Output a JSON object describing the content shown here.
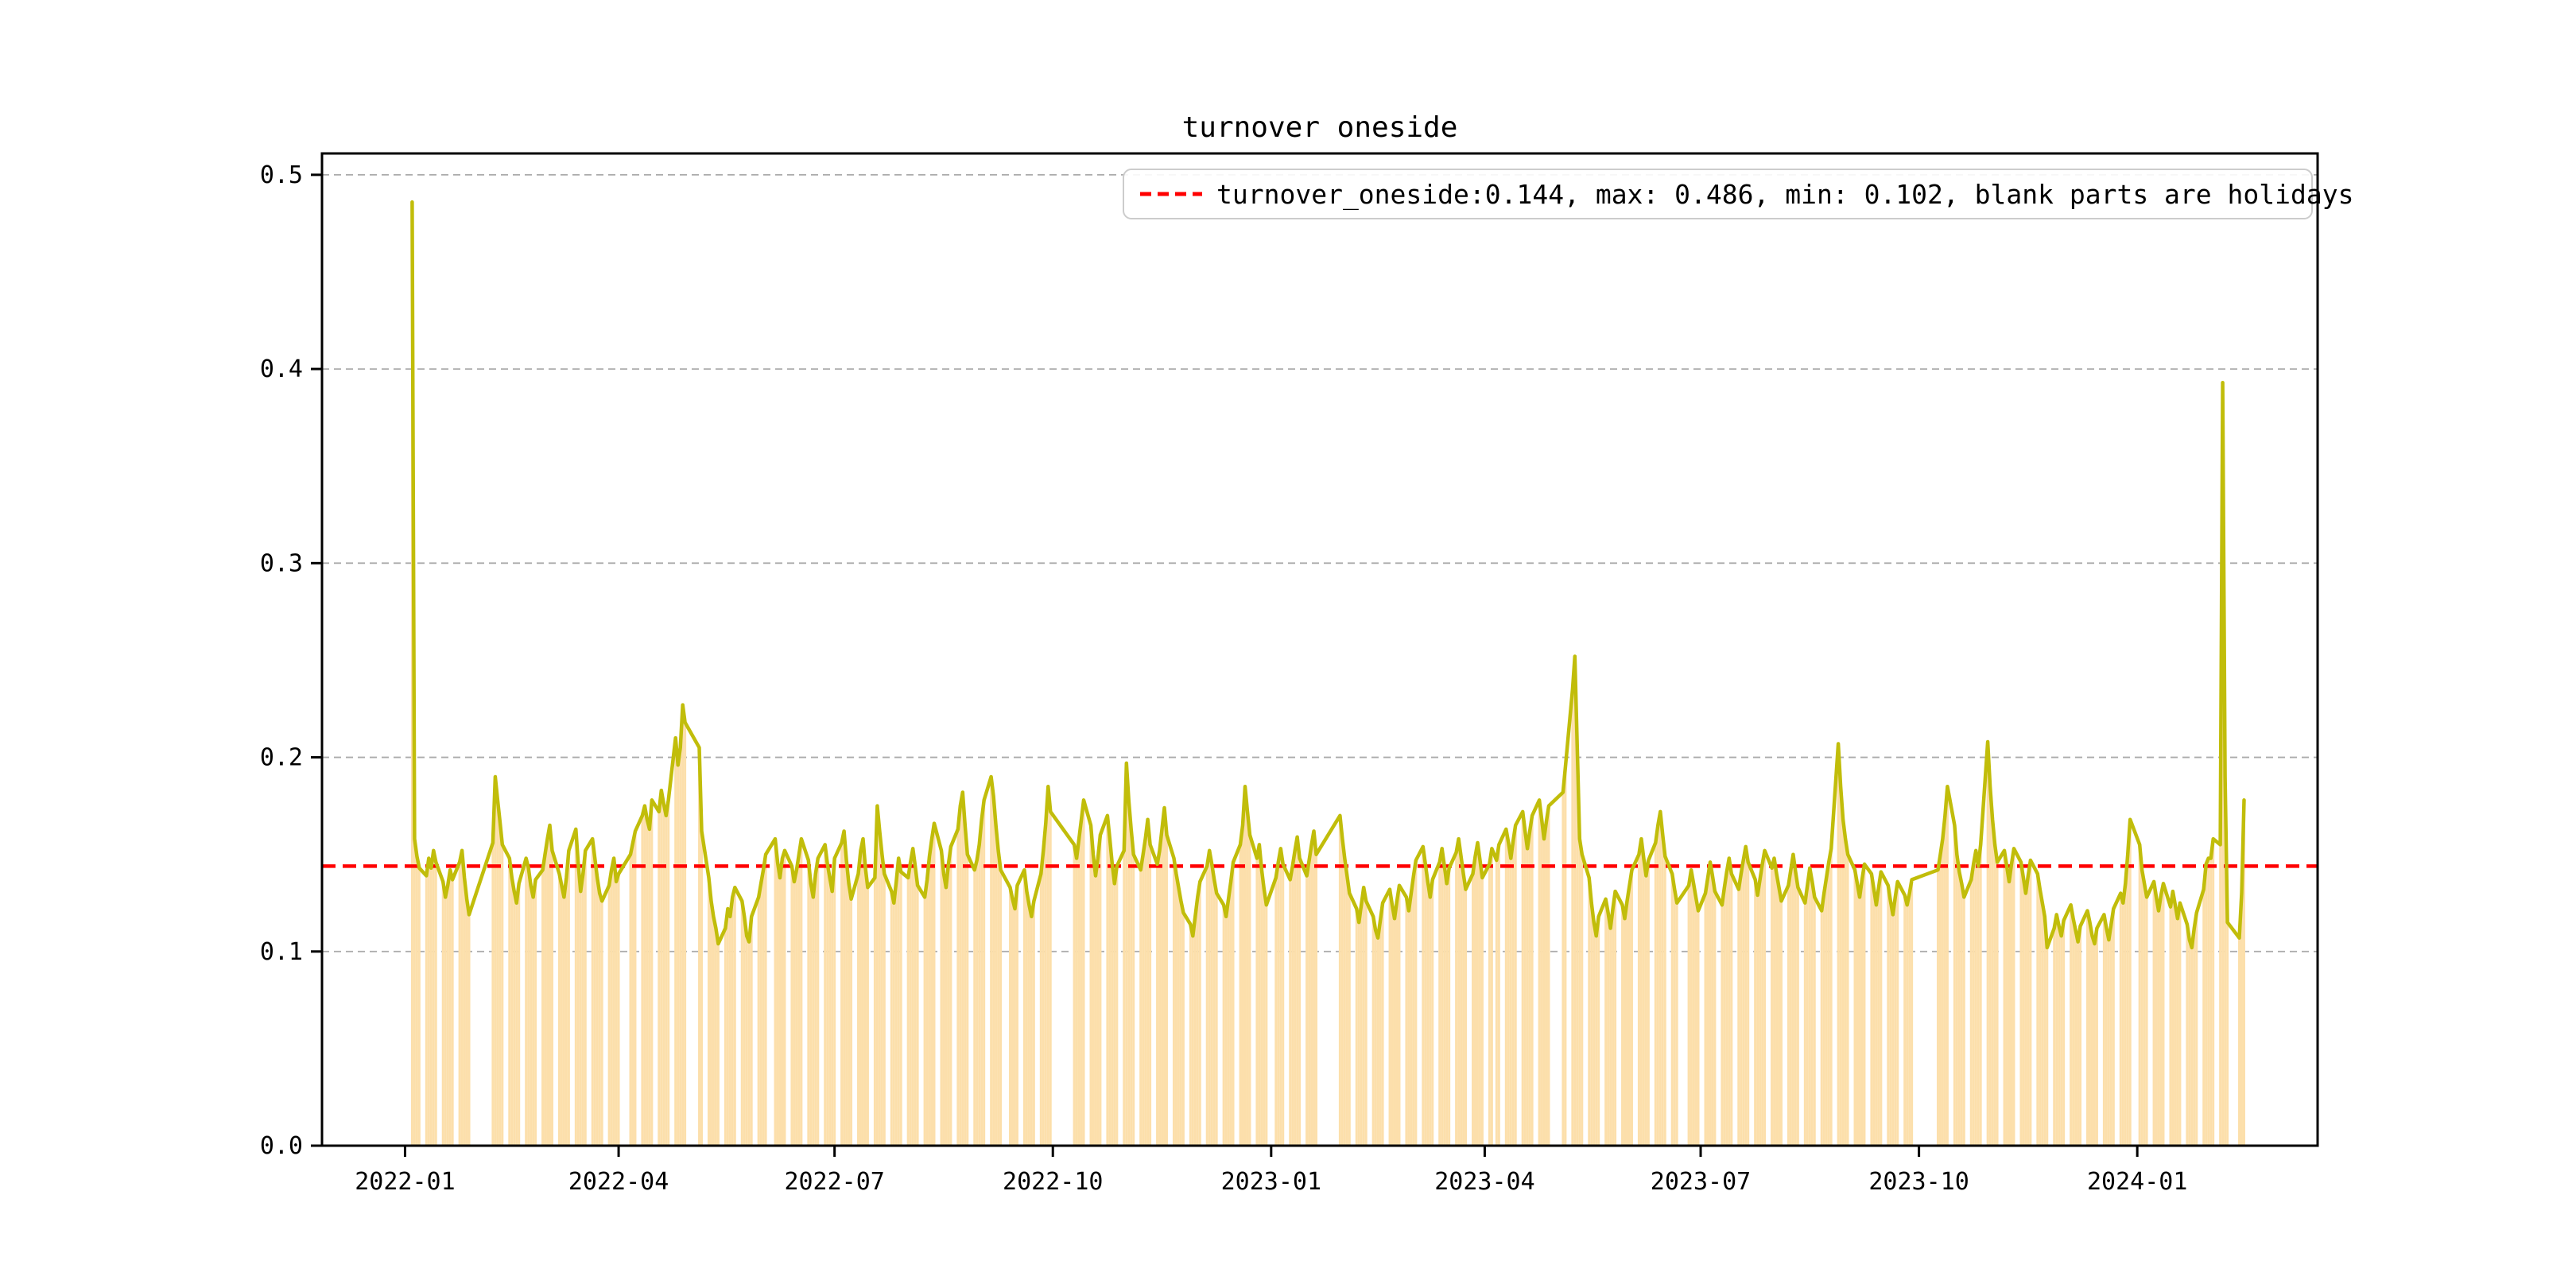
{
  "figure": {
    "title": "turnover oneside",
    "background": "#ffffff"
  },
  "legend": {
    "label": "turnover_oneside:0.144, max: 0.486, min: 0.102, blank parts are holidays",
    "marker_color": "#ff0000",
    "marker_style": "dashed"
  },
  "axes": {
    "y_ticks": [
      {
        "label": "0.0",
        "value": 0.0
      },
      {
        "label": "0.1",
        "value": 0.1
      },
      {
        "label": "0.2",
        "value": 0.2
      },
      {
        "label": "0.3",
        "value": 0.3
      },
      {
        "label": "0.4",
        "value": 0.4
      },
      {
        "label": "0.5",
        "value": 0.5
      }
    ],
    "x_ticks": [
      {
        "label": "2022-01",
        "date": "2022-01-01"
      },
      {
        "label": "2022-04",
        "date": "2022-04-01"
      },
      {
        "label": "2022-07",
        "date": "2022-07-01"
      },
      {
        "label": "2022-10",
        "date": "2022-10-01"
      },
      {
        "label": "2023-01",
        "date": "2023-01-01"
      },
      {
        "label": "2023-04",
        "date": "2023-04-01"
      },
      {
        "label": "2023-07",
        "date": "2023-07-01"
      },
      {
        "label": "2023-10",
        "date": "2023-10-01"
      },
      {
        "label": "2024-01",
        "date": "2024-01-01"
      }
    ],
    "grid_color": "#ababab",
    "spine_color": "#000000"
  },
  "chart_data": {
    "type": "line",
    "title": "turnover oneside",
    "ylim": [
      0,
      0.511
    ],
    "xlim": [
      "2021-11-27",
      "2024-03-17"
    ],
    "grid": "horizontal-dashed",
    "legend_position": "upper right",
    "mean_line": {
      "value": 0.144,
      "color": "#ff0000",
      "style": "dashed"
    },
    "stats": {
      "mean": 0.144,
      "max": 0.486,
      "min": 0.102
    },
    "bars": {
      "color": "#fcdfab",
      "note": "daily bars equal line values; blank parts are holidays/weekends"
    },
    "holidays": [
      "2022-01-03",
      "2022-01-31",
      "2022-02-01",
      "2022-02-02",
      "2022-02-03",
      "2022-02-04",
      "2022-04-04",
      "2022-04-05",
      "2022-05-02",
      "2022-05-03",
      "2022-05-04",
      "2022-06-03",
      "2022-09-12",
      "2022-10-03",
      "2022-10-04",
      "2022-10-05",
      "2022-10-06",
      "2022-10-07",
      "2023-01-02",
      "2023-01-23",
      "2023-01-24",
      "2023-01-25",
      "2023-01-26",
      "2023-01-27",
      "2023-04-05",
      "2023-05-01",
      "2023-05-02",
      "2023-05-03",
      "2023-06-22",
      "2023-06-23",
      "2023-09-29",
      "2023-10-02",
      "2023-10-03",
      "2023-10-04",
      "2023-10-05",
      "2023-10-06",
      "2024-01-01",
      "2024-02-09",
      "2024-02-12"
    ],
    "series": [
      {
        "name": "turnover_oneside",
        "color": "#c1bd0a",
        "start_date": "2022-01-04",
        "frequency": "trading-days",
        "values": [
          0.486,
          0.158,
          0.149,
          0.143,
          0.139,
          0.148,
          0.143,
          0.152,
          0.146,
          0.136,
          0.128,
          0.134,
          0.142,
          0.137,
          0.146,
          0.152,
          0.138,
          0.127,
          0.119,
          0.156,
          0.19,
          0.178,
          0.167,
          0.155,
          0.148,
          0.138,
          0.131,
          0.125,
          0.135,
          0.148,
          0.143,
          0.134,
          0.128,
          0.137,
          0.142,
          0.15,
          0.158,
          0.165,
          0.152,
          0.14,
          0.134,
          0.128,
          0.138,
          0.152,
          0.163,
          0.145,
          0.131,
          0.14,
          0.152,
          0.158,
          0.148,
          0.138,
          0.13,
          0.126,
          0.134,
          0.142,
          0.148,
          0.136,
          0.14,
          0.15,
          0.156,
          0.162,
          0.17,
          0.175,
          0.168,
          0.163,
          0.178,
          0.172,
          0.183,
          0.176,
          0.17,
          0.178,
          0.21,
          0.196,
          0.205,
          0.227,
          0.218,
          0.205,
          0.162,
          0.138,
          0.126,
          0.118,
          0.112,
          0.104,
          0.112,
          0.122,
          0.118,
          0.128,
          0.133,
          0.126,
          0.118,
          0.108,
          0.105,
          0.118,
          0.128,
          0.135,
          0.142,
          0.15,
          0.158,
          0.146,
          0.138,
          0.148,
          0.152,
          0.144,
          0.136,
          0.142,
          0.15,
          0.158,
          0.147,
          0.135,
          0.128,
          0.14,
          0.148,
          0.155,
          0.145,
          0.138,
          0.131,
          0.148,
          0.156,
          0.162,
          0.147,
          0.135,
          0.127,
          0.14,
          0.152,
          0.158,
          0.143,
          0.133,
          0.138,
          0.175,
          0.162,
          0.15,
          0.14,
          0.131,
          0.125,
          0.136,
          0.148,
          0.141,
          0.138,
          0.146,
          0.153,
          0.144,
          0.134,
          0.128,
          0.137,
          0.149,
          0.158,
          0.166,
          0.152,
          0.14,
          0.133,
          0.145,
          0.154,
          0.163,
          0.175,
          0.182,
          0.165,
          0.15,
          0.142,
          0.147,
          0.155,
          0.168,
          0.178,
          0.19,
          0.18,
          0.165,
          0.152,
          0.142,
          0.133,
          0.127,
          0.122,
          0.134,
          0.142,
          0.131,
          0.124,
          0.118,
          0.126,
          0.14,
          0.152,
          0.166,
          0.185,
          0.172,
          0.155,
          0.148,
          0.158,
          0.168,
          0.178,
          0.165,
          0.15,
          0.139,
          0.148,
          0.16,
          0.17,
          0.158,
          0.145,
          0.135,
          0.144,
          0.152,
          0.197,
          0.178,
          0.163,
          0.15,
          0.142,
          0.15,
          0.158,
          0.168,
          0.155,
          0.145,
          0.152,
          0.163,
          0.174,
          0.16,
          0.148,
          0.14,
          0.133,
          0.126,
          0.12,
          0.114,
          0.108,
          0.118,
          0.128,
          0.136,
          0.144,
          0.152,
          0.145,
          0.137,
          0.13,
          0.124,
          0.118,
          0.127,
          0.136,
          0.146,
          0.155,
          0.165,
          0.185,
          0.172,
          0.16,
          0.148,
          0.155,
          0.142,
          0.132,
          0.124,
          0.138,
          0.146,
          0.153,
          0.145,
          0.137,
          0.144,
          0.152,
          0.159,
          0.148,
          0.139,
          0.147,
          0.155,
          0.162,
          0.15,
          0.17,
          0.158,
          0.148,
          0.139,
          0.13,
          0.122,
          0.115,
          0.124,
          0.133,
          0.126,
          0.118,
          0.111,
          0.107,
          0.116,
          0.125,
          0.132,
          0.124,
          0.117,
          0.126,
          0.134,
          0.128,
          0.121,
          0.13,
          0.139,
          0.147,
          0.154,
          0.145,
          0.136,
          0.128,
          0.137,
          0.146,
          0.153,
          0.144,
          0.135,
          0.143,
          0.151,
          0.158,
          0.149,
          0.14,
          0.132,
          0.14,
          0.149,
          0.156,
          0.147,
          0.138,
          0.145,
          0.153,
          0.147,
          0.155,
          0.163,
          0.156,
          0.148,
          0.157,
          0.165,
          0.172,
          0.162,
          0.153,
          0.162,
          0.17,
          0.178,
          0.168,
          0.158,
          0.167,
          0.175,
          0.182,
          0.195,
          0.235,
          0.252,
          0.205,
          0.158,
          0.15,
          0.138,
          0.125,
          0.115,
          0.108,
          0.118,
          0.127,
          0.12,
          0.112,
          0.122,
          0.131,
          0.124,
          0.117,
          0.126,
          0.134,
          0.142,
          0.15,
          0.158,
          0.148,
          0.139,
          0.147,
          0.156,
          0.165,
          0.172,
          0.16,
          0.149,
          0.14,
          0.132,
          0.125,
          0.134,
          0.142,
          0.135,
          0.128,
          0.121,
          0.13,
          0.138,
          0.146,
          0.139,
          0.131,
          0.124,
          0.133,
          0.141,
          0.148,
          0.14,
          0.132,
          0.14,
          0.147,
          0.154,
          0.146,
          0.137,
          0.129,
          0.137,
          0.145,
          0.152,
          0.143,
          0.148,
          0.14,
          0.133,
          0.126,
          0.134,
          0.142,
          0.15,
          0.141,
          0.133,
          0.125,
          0.134,
          0.143,
          0.136,
          0.128,
          0.121,
          0.13,
          0.138,
          0.146,
          0.153,
          0.207,
          0.185,
          0.168,
          0.158,
          0.15,
          0.142,
          0.135,
          0.128,
          0.137,
          0.145,
          0.14,
          0.132,
          0.124,
          0.133,
          0.141,
          0.134,
          0.126,
          0.119,
          0.128,
          0.136,
          0.129,
          0.124,
          0.13,
          0.137,
          0.142,
          0.15,
          0.158,
          0.17,
          0.185,
          0.165,
          0.15,
          0.141,
          0.135,
          0.128,
          0.137,
          0.145,
          0.152,
          0.144,
          0.155,
          0.208,
          0.185,
          0.168,
          0.155,
          0.146,
          0.152,
          0.144,
          0.136,
          0.145,
          0.153,
          0.146,
          0.138,
          0.13,
          0.139,
          0.147,
          0.14,
          0.132,
          0.125,
          0.118,
          0.102,
          0.112,
          0.119,
          0.113,
          0.108,
          0.116,
          0.124,
          0.117,
          0.111,
          0.105,
          0.113,
          0.121,
          0.115,
          0.108,
          0.104,
          0.112,
          0.119,
          0.112,
          0.106,
          0.114,
          0.122,
          0.13,
          0.125,
          0.135,
          0.15,
          0.168,
          0.155,
          0.142,
          0.135,
          0.128,
          0.136,
          0.128,
          0.121,
          0.129,
          0.135,
          0.123,
          0.131,
          0.124,
          0.117,
          0.125,
          0.114,
          0.106,
          0.102,
          0.112,
          0.12,
          0.132,
          0.145,
          0.148,
          0.148,
          0.158,
          0.155,
          0.393,
          0.19,
          0.115,
          0.107,
          0.13,
          0.178
        ]
      }
    ]
  }
}
